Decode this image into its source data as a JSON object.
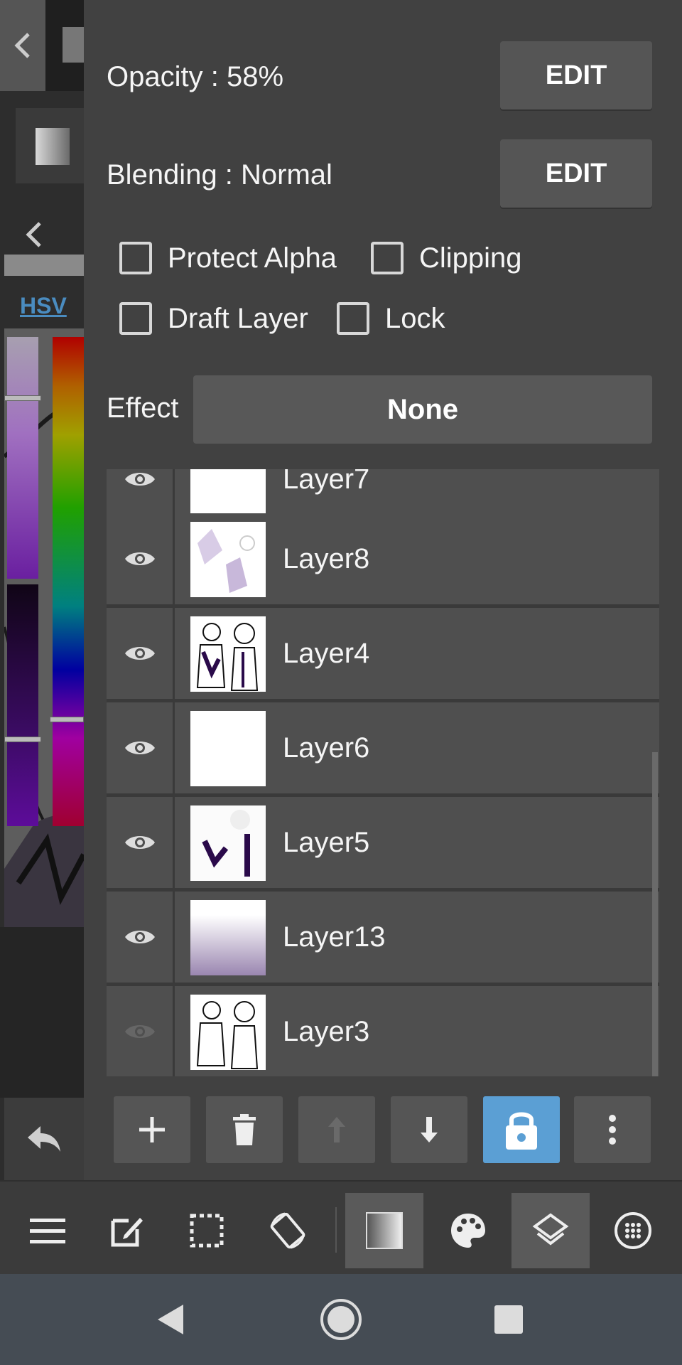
{
  "panel": {
    "opacity_label": "Opacity : 58%",
    "opacity_edit": "EDIT",
    "blending_label": "Blending : Normal",
    "blending_edit": "EDIT",
    "protect_alpha": "Protect Alpha",
    "clipping": "Clipping",
    "draft_layer": "Draft Layer",
    "lock": "Lock",
    "effect_label": "Effect",
    "effect_value": "None"
  },
  "left_strip": {
    "hsv_label": "HSV"
  },
  "layers": [
    {
      "name": "Layer7",
      "visible": true
    },
    {
      "name": "Layer8",
      "visible": true
    },
    {
      "name": "Layer4",
      "visible": true
    },
    {
      "name": "Layer6",
      "visible": true
    },
    {
      "name": "Layer5",
      "visible": true
    },
    {
      "name": "Layer13",
      "visible": true
    },
    {
      "name": "Layer3",
      "visible": false
    }
  ],
  "layer_toolbar": [
    "add-icon",
    "trash-icon",
    "arrow-up-icon",
    "arrow-down-icon",
    "lock-icon",
    "more-vert-icon"
  ],
  "bottom_toolbar": [
    "menu-icon",
    "edit-icon",
    "selection-icon",
    "rotate-icon",
    "brush-color-icon",
    "palette-icon",
    "layers-icon",
    "materials-icon"
  ],
  "colors": {
    "panel_bg": "#414141",
    "row_bg": "#4f4f4f",
    "accent": "#5b9fd4",
    "hsv_link": "#4a8cc0"
  }
}
